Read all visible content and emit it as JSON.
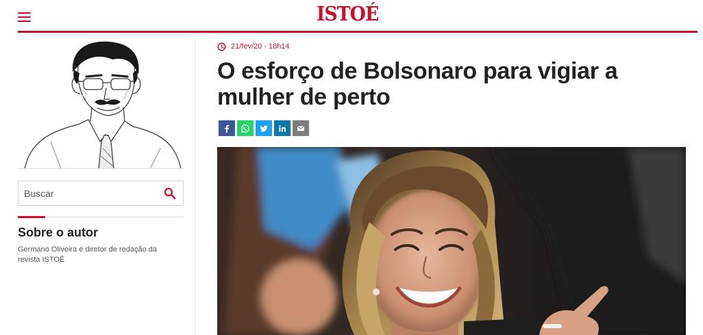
{
  "header": {
    "logo_text": "ISTOÉ",
    "menu_icon": "hamburger-menu-icon",
    "brand_color": "#c8102e"
  },
  "sidebar": {
    "author_image_icon": "author-sketch-portrait",
    "search": {
      "placeholder": "Buscar",
      "icon": "search-icon"
    },
    "about": {
      "title": "Sobre o autor",
      "text": "Germano Oliveira é diretor de redação da revista ISTOÉ"
    }
  },
  "article": {
    "date": "21/fev/20 - 18h14",
    "date_icon": "clock-icon",
    "headline": "O esforço de Bolsonaro para vigiar a mulher de perto",
    "share_buttons": [
      {
        "icon": "facebook-icon",
        "color": "#3b5998"
      },
      {
        "icon": "whatsapp-icon",
        "color": "#25d366"
      },
      {
        "icon": "twitter-icon",
        "color": "#1da1f2"
      },
      {
        "icon": "linkedin-icon",
        "color": "#0e76a8"
      },
      {
        "icon": "email-icon",
        "color": "#7d7d7d"
      }
    ],
    "photo_icon": "article-photo"
  }
}
